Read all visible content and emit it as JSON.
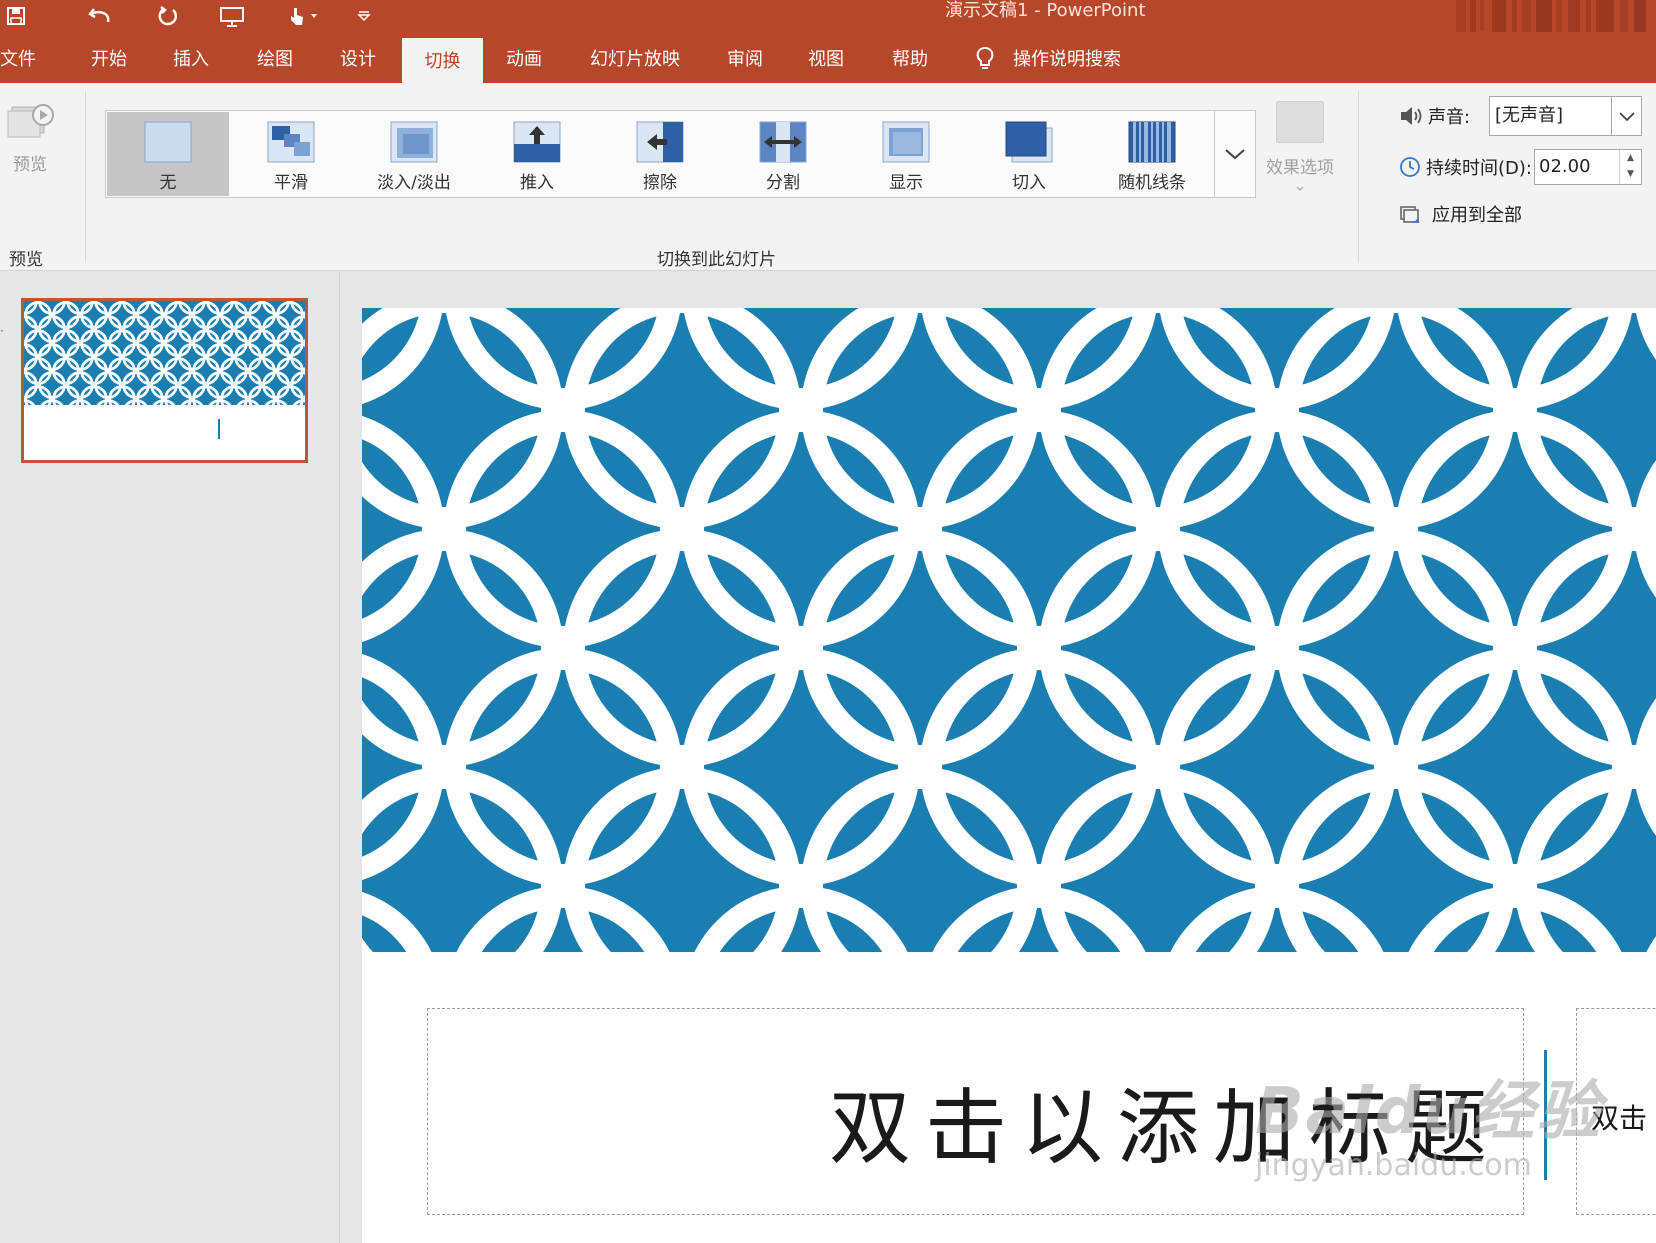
{
  "window": {
    "title": "演示文稿1  -  PowerPoint"
  },
  "tabs": [
    "文件",
    "开始",
    "插入",
    "绘图",
    "设计",
    "切换",
    "动画",
    "幻灯片放映",
    "审阅",
    "视图",
    "帮助"
  ],
  "active_tab": "切换",
  "tell_me": "操作说明搜索",
  "ribbon": {
    "preview": {
      "button_label": "预览",
      "group_label": "预览"
    },
    "transitions": {
      "group_label": "切换到此幻灯片",
      "items": [
        "无",
        "平滑",
        "淡入/淡出",
        "推入",
        "擦除",
        "分割",
        "显示",
        "切入",
        "随机线条"
      ],
      "selected": "无"
    },
    "effect_options": "效果选项",
    "timing": {
      "sound_label": "声音:",
      "sound_value": "[无声音]",
      "duration_label": "持续时间(D):",
      "duration_value": "02.00",
      "apply_all": "应用到全部"
    }
  },
  "slide": {
    "title_placeholder": "双击以添加标题",
    "subtitle_placeholder": "双击",
    "pattern_color": "#1a7fb0"
  },
  "watermark": {
    "main": "Baidu经验",
    "sub": "jingyan.baidu.com"
  }
}
